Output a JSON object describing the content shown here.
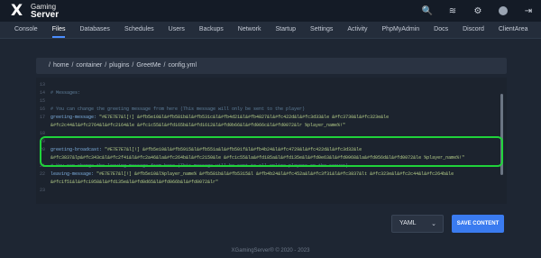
{
  "brand": {
    "top": "Gaming",
    "bottom": "Server",
    "mark": "X"
  },
  "top_icons": [
    {
      "name": "search-icon",
      "glyph": "🔍"
    },
    {
      "name": "layers-icon",
      "glyph": "≋"
    },
    {
      "name": "gear-icon",
      "glyph": "⚙"
    },
    {
      "name": "avatar",
      "glyph": ""
    },
    {
      "name": "logout-icon",
      "glyph": "⇥"
    }
  ],
  "nav": {
    "items": [
      "Console",
      "Files",
      "Databases",
      "Schedules",
      "Users",
      "Backups",
      "Network",
      "Startup",
      "Settings",
      "Activity",
      "PhpMyAdmin",
      "Docs",
      "Discord",
      "ClientArea"
    ],
    "active": "Files"
  },
  "breadcrumb": [
    "/",
    "home",
    "/",
    "container",
    "/",
    "plugins",
    "/",
    "GreetMe",
    "/",
    "config.yml"
  ],
  "editor": {
    "lines": [
      {
        "n": "13",
        "kind": "blank",
        "text": ""
      },
      {
        "n": "14",
        "kind": "comment",
        "text": "# Messages:"
      },
      {
        "n": "15",
        "kind": "blank",
        "text": ""
      },
      {
        "n": "16",
        "kind": "comment",
        "text": "# You can change the greeting message from here (This message will only be sent to the player)"
      },
      {
        "n": "17",
        "kind": "kv",
        "key": "greeting-message:",
        "value": "\"#E7E7E7&l[!] &#fb5e10&l&#fb581b&l&#fb531c&l&#fb4d21&l&#fb4827&l&#fc422d&l&#fc3d33&le &#fc3730&l&#fc323e&le"
      },
      {
        "n": "",
        "kind": "cont",
        "text": "&#fc2c44&l&#fc2764&l&#fc2164&le &#fc1c55&l&#fd165b&l&#fd1612&l&#fd0b66&l&#fd066c&l&#fd0072&lr %player_name%!\""
      },
      {
        "n": "18",
        "kind": "blank",
        "text": ""
      },
      {
        "n": "19",
        "kind": "blank",
        "text": ""
      },
      {
        "n": "20",
        "kind": "kv",
        "key": "greeting-broadcast:",
        "value": "\"#E7E7E7&l[!] &#fb5e10&l&#fb5915&l&#fb551a&l&#fb501f&l&#fb4b24&l&#fc4729&l&#fc422d&l&#fc3d32&le"
      },
      {
        "n": "",
        "kind": "cont",
        "text": "&#fc3837&lp&#fc343c&l&#fc2f41&l&#fc2a46&la&#fc264b&l&#fc2150&le &#fc1c55&la&#fd185a&l&#fd135e&l&#fd0e63&l&#fd0968&la&#fd056d&l&#fd0072&le %player_name%!\""
      },
      {
        "n": "21",
        "kind": "comment",
        "text": "# You can change the leaving message from here (This message will be sent to all online players on the server)"
      },
      {
        "n": "22",
        "kind": "kv",
        "key": "leaving-message:",
        "value": "\"#E7E7E7&l[!] &#fb5e10&l%player_name% &#fb581b&l&#fb5315&l &#fb4b24&l&#fc452a&l&#fc3f31&l&#fc3837&lt &#fc323e&l&#fc2c44&l&#fc264b&le"
      },
      {
        "n": "",
        "kind": "cont",
        "text": "&#fc1f51&l&#fc1958&l&#fd135e&l&#fd0d65&l&#fd066b&l&#fd0072&lr\""
      },
      {
        "n": "23",
        "kind": "blank",
        "text": ""
      }
    ]
  },
  "format_select": {
    "value": "YAML"
  },
  "save_button": {
    "label": "SAVE CONTENT"
  },
  "footer": {
    "text": "XGamingServer® © 2020 - 2023"
  },
  "colors": {
    "highlight": "#1fd33a",
    "accent": "#3a7bf0",
    "bg": "#1e2633"
  }
}
